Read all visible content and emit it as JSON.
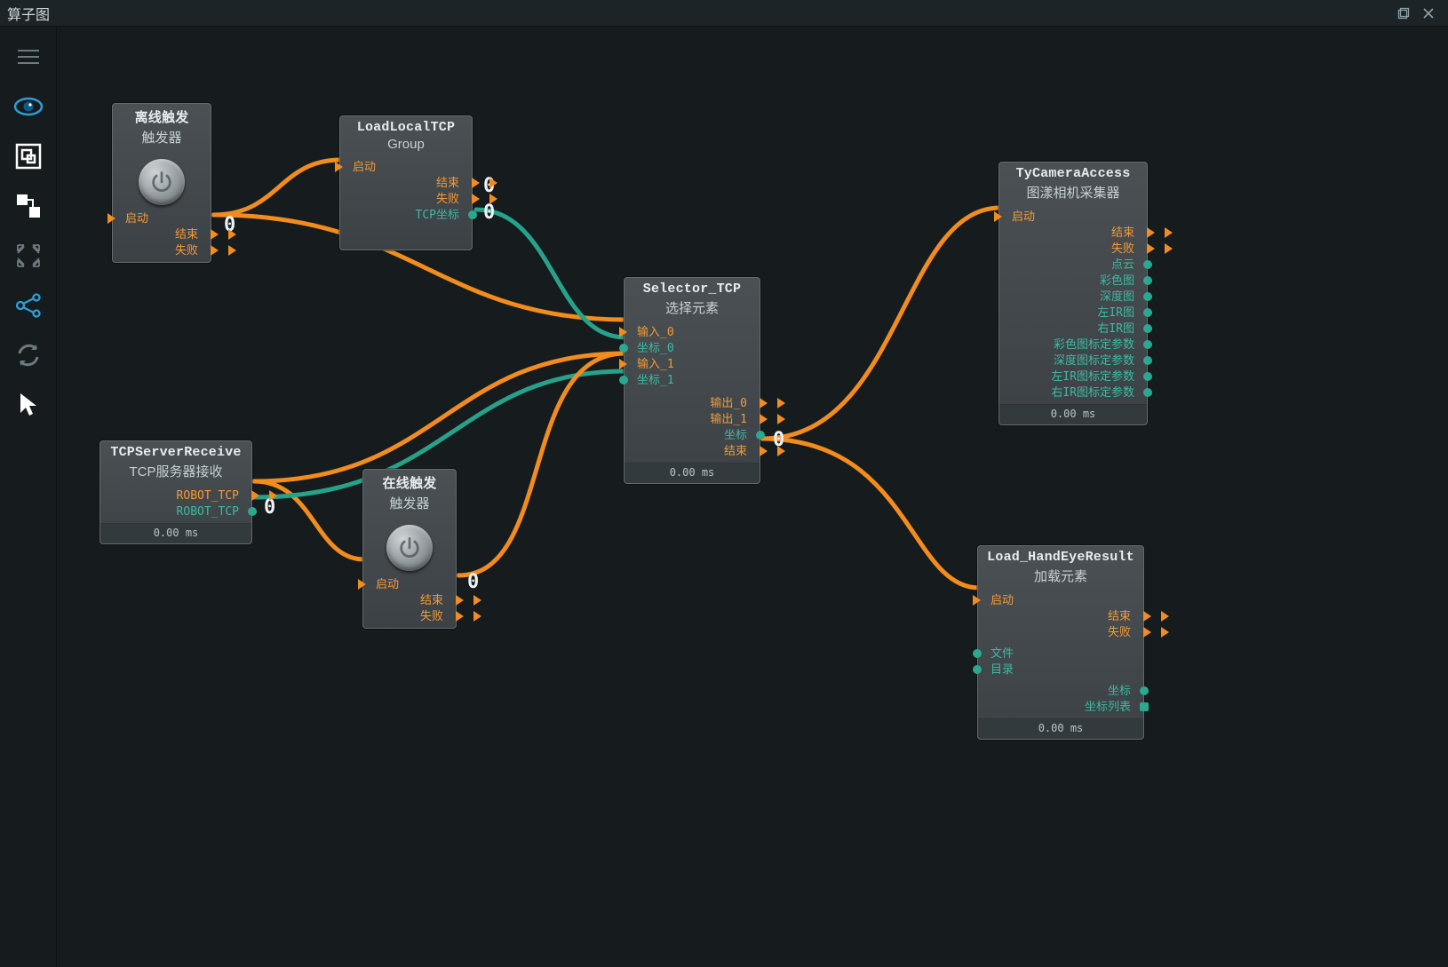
{
  "window": {
    "title": "算子图"
  },
  "sidebar": {
    "menu": "菜单",
    "eye": "预览",
    "group": "分组",
    "nodes": "节点",
    "fit": "适应",
    "branch": "分支",
    "refresh": "刷新",
    "cursor": "选择"
  },
  "nodes": {
    "offline": {
      "title": "离线触发",
      "subtitle": "触发器",
      "in_start": "启动",
      "out_end": "结束",
      "out_fail": "失败"
    },
    "loadtcp": {
      "title": "LoadLocalTCP",
      "subtitle": "Group",
      "in_start": "启动",
      "out_end": "结束",
      "out_fail": "失败",
      "out_coord": "TCP坐标"
    },
    "tcprecv": {
      "title": "TCPServerReceive",
      "subtitle": "TCP服务器接收",
      "out_robot1": "ROBOT_TCP",
      "out_robot2": "ROBOT_TCP",
      "footer": "0.00 ms"
    },
    "online": {
      "title": "在线触发",
      "subtitle": "触发器",
      "in_start": "启动",
      "out_end": "结束",
      "out_fail": "失败"
    },
    "selector": {
      "title": "Selector_TCP",
      "subtitle": "选择元素",
      "in0": "输入_0",
      "c0": "坐标_0",
      "in1": "输入_1",
      "c1": "坐标_1",
      "out0": "输出_0",
      "out1": "输出_1",
      "out_coord": "坐标",
      "out_end": "结束",
      "footer": "0.00 ms"
    },
    "camera": {
      "title": "TyCameraAccess",
      "subtitle": "图漾相机采集器",
      "in_start": "启动",
      "o_end": "结束",
      "o_fail": "失败",
      "o_pc": "点云",
      "o_rgb": "彩色图",
      "o_depth": "深度图",
      "o_lir": "左IR图",
      "o_rir": "右IR图",
      "o_rgbcal": "彩色图标定参数",
      "o_depthcal": "深度图标定参数",
      "o_lircal": "左IR图标定参数",
      "o_rircal": "右IR图标定参数",
      "footer": "0.00 ms"
    },
    "handeye": {
      "title": "Load_HandEyeResult",
      "subtitle": "加载元素",
      "in_start": "启动",
      "in_file": "文件",
      "in_dir": "目录",
      "o_end": "结束",
      "o_fail": "失败",
      "o_coord": "坐标",
      "o_coordlist": "坐标列表",
      "footer": "0.00 ms"
    }
  },
  "flowlabels": {
    "a": "0",
    "b": "0",
    "c": "0",
    "d": "0",
    "e": "0",
    "f": "0"
  }
}
